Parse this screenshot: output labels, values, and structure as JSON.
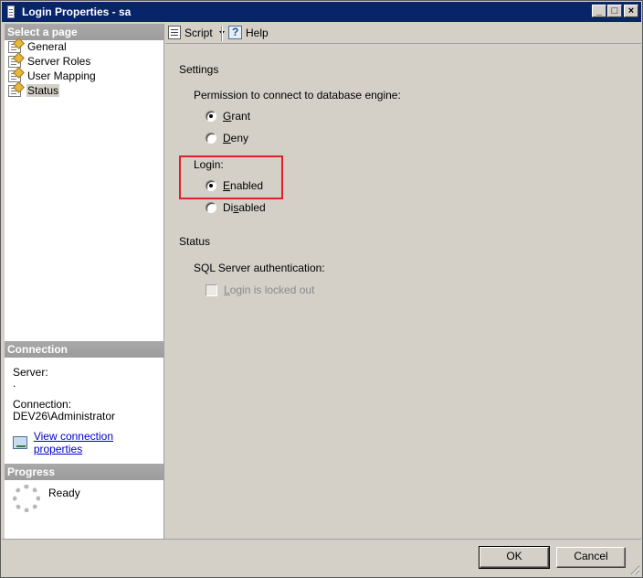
{
  "window": {
    "title": "Login Properties - sa",
    "controls": {
      "minimize": "_",
      "maximize": "□",
      "close": "×"
    }
  },
  "left": {
    "select_page_header": "Select a page",
    "pages": [
      {
        "label": "General",
        "icon": "page-icon"
      },
      {
        "label": "Server Roles",
        "icon": "page-icon"
      },
      {
        "label": "User Mapping",
        "icon": "page-icon"
      },
      {
        "label": "Status",
        "icon": "page-icon",
        "selected": true
      }
    ],
    "connection_header": "Connection",
    "server_label": "Server:",
    "server_value": ".",
    "connection_label": "Connection:",
    "connection_value": "DEV26\\Administrator",
    "view_connection_link": "View connection properties",
    "progress_header": "Progress",
    "progress_status": "Ready"
  },
  "toolbar": {
    "script_label": "Script",
    "help_label": "Help"
  },
  "settings": {
    "section_title": "Settings",
    "permission_label": "Permission to connect to database engine:",
    "grant": {
      "pre": "",
      "accel": "G",
      "post": "rant",
      "checked": true
    },
    "deny": {
      "pre": "",
      "accel": "D",
      "post": "eny",
      "checked": false
    },
    "login_label": "Login:",
    "enabled": {
      "pre": "",
      "accel": "E",
      "post": "nabled",
      "checked": true
    },
    "disabled": {
      "pre": "Di",
      "accel": "s",
      "post": "abled",
      "checked": false
    }
  },
  "status": {
    "section_title": "Status",
    "sql_auth_label": "SQL Server authentication:",
    "locked_out": {
      "pre": "",
      "accel": "L",
      "post": "ogin is locked out",
      "checked": false,
      "enabled": false
    }
  },
  "buttons": {
    "ok": "OK",
    "cancel": "Cancel"
  },
  "colors": {
    "titlebar": "#08246b",
    "highlight_box": "#e0202a",
    "link": "#0000cc"
  }
}
